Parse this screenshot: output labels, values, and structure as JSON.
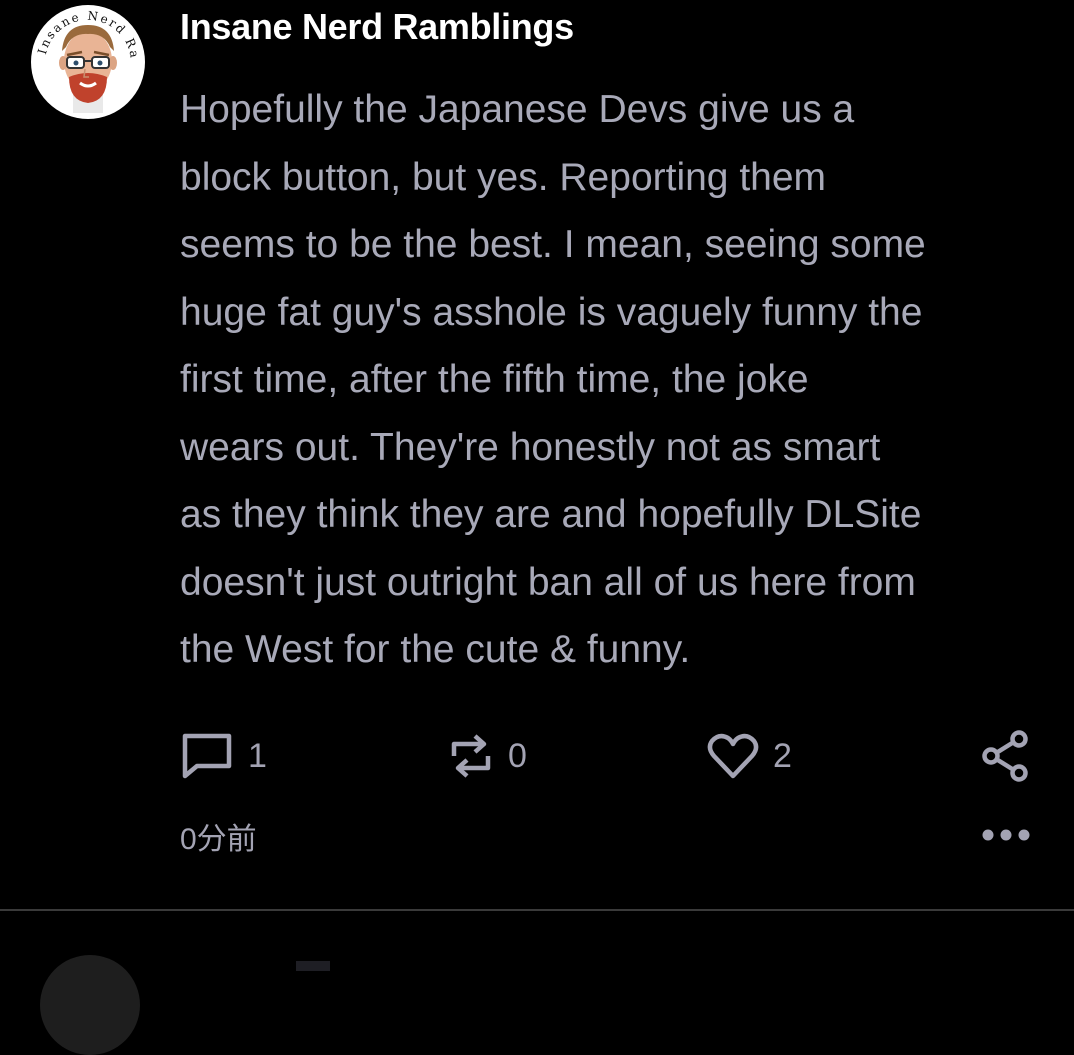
{
  "post": {
    "author": "Insane Nerd Ramblings",
    "avatar_ring_text": "Insane Nerd Ramblings",
    "body_lines": [
      "Hopefully the Japanese Devs give us a",
      "block button, but yes. Reporting them",
      "seems to be the best. I mean, seeing some",
      "huge fat guy's asshole is vaguely funny the",
      "first time, after the fifth time, the joke",
      "wears out. They're honestly not as smart",
      "as they think they are and hopefully DLSite",
      "doesn't just outright ban all of us here from",
      "the West for the cute & funny."
    ],
    "actions": {
      "reply": {
        "icon": "comment-icon",
        "count": "1"
      },
      "repost": {
        "icon": "repost-icon",
        "count": "0"
      },
      "like": {
        "icon": "heart-icon",
        "count": "2"
      },
      "share": {
        "icon": "share-icon"
      }
    },
    "timestamp": "0分前",
    "more_icon": "more-horizontal-icon"
  },
  "colors": {
    "background": "#000000",
    "author": "#ffffff",
    "body_text": "#a8a9b8",
    "secondary_text": "#a3a3b3",
    "divider": "#3a3a3a"
  }
}
